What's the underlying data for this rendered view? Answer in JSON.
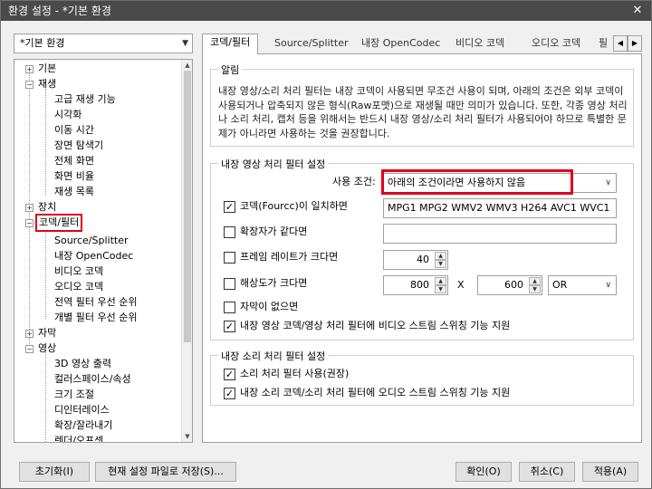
{
  "window": {
    "title": "환경 설정 - *기본 환경",
    "close_glyph": "✕"
  },
  "profile": {
    "selected": "*기본 환경"
  },
  "tree": {
    "items": [
      {
        "label": "기본",
        "expander": "+"
      },
      {
        "label": "재생",
        "expander": "−"
      },
      {
        "label": "고급 재생 기능"
      },
      {
        "label": "시각화"
      },
      {
        "label": "이동 시간"
      },
      {
        "label": "장면 탐색기"
      },
      {
        "label": "전체 화면"
      },
      {
        "label": "화면 비율"
      },
      {
        "label": "재생 목록"
      },
      {
        "label": "장치",
        "expander": "+"
      },
      {
        "label": "코덱/필터",
        "expander": "−"
      },
      {
        "label": "Source/Splitter"
      },
      {
        "label": "내장 OpenCodec"
      },
      {
        "label": "비디오 코덱"
      },
      {
        "label": "오디오 코덱"
      },
      {
        "label": "전역 필터 우선 순위"
      },
      {
        "label": "개별 필터 우선 순위"
      },
      {
        "label": "자막",
        "expander": "+"
      },
      {
        "label": "영상",
        "expander": "−"
      },
      {
        "label": "3D 영상 출력"
      },
      {
        "label": "컬러스페이스/속성"
      },
      {
        "label": "크기 조절"
      },
      {
        "label": "디인터레이스"
      },
      {
        "label": "확장/잘라내기"
      },
      {
        "label": "렌더/오프셋"
      }
    ]
  },
  "tabs": [
    {
      "label": "코덱/필터"
    },
    {
      "label": "Source/Splitter"
    },
    {
      "label": "내장 OpenCodec"
    },
    {
      "label": "비디오 코덱"
    },
    {
      "label": "오디오 코덱"
    },
    {
      "label": "필"
    }
  ],
  "notice": {
    "title": "알림",
    "text": "내장 영상/소리 처리 필터는 내장 코덱이 사용되면 무조건 사용이 되며, 아래의 조건은 외부 코덱이 사용되거나 압축되지 않은 형식(Raw포맷)으로 재생될 때만 의미가 있습니다. 또한, 각종 영상 처리나 소리 처리, 캡처 등을 위해서는 반드시 내장 영상/소리 처리 필터가 사용되어야 하므로 특별한 문제가 아니라면 사용하는 것을 권장합니다."
  },
  "video_filter": {
    "title": "내장 영상 처리 필터 설정",
    "condition_label": "사용 조건:",
    "condition_value": "아래의 조건이라면 사용하지 않음",
    "fourcc_label": "코덱(Fourcc)이 일치하면",
    "fourcc_value": "MPG1 MPG2 WMV2 WMV3 H264 AVC1 WVC1",
    "ext_label": "확장자가 같다면",
    "ext_value": "",
    "framerate_label": "프레임 레이트가 크다면",
    "framerate_value": "40",
    "resolution_label": "해상도가 크다면",
    "res_w": "800",
    "res_x": "X",
    "res_h": "600",
    "res_op": "OR",
    "nosub_label": "자막이 없으면",
    "switch_label": "내장 영상 코덱/영상 처리 필터에  비디오 스트림 스위칭 기능 지원"
  },
  "audio_filter": {
    "title": "내장 소리 처리 필터 설정",
    "use_label": "소리 처리 필터 사용(권장)",
    "switch_label": "내장 소리 코덱/소리 처리 필터에  오디오 스트림 스위칭 기능 지원"
  },
  "buttons": {
    "reset": "초기화(I)",
    "save_current": "현재 설정 파일로 저장(S)...",
    "ok": "확인(O)",
    "cancel": "취소(C)",
    "apply": "적용(A)"
  }
}
